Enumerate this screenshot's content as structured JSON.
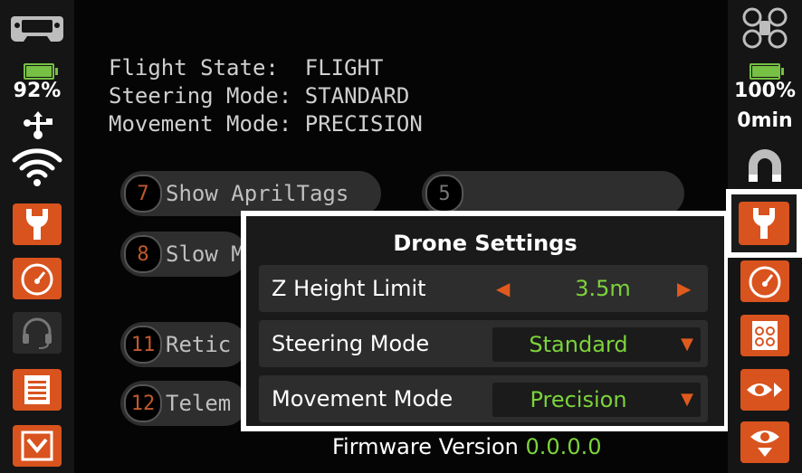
{
  "left_sidebar": {
    "battery_percent": "92%",
    "battery_level": 0.92
  },
  "right_sidebar": {
    "battery_percent": "100%",
    "flight_time": "0min",
    "battery_level": 1.0
  },
  "status": {
    "flight_state_label": "Flight State:",
    "flight_state_value": "FLIGHT",
    "steering_mode_label": "Steering Mode:",
    "steering_mode_value": "STANDARD",
    "movement_mode_label": "Movement Mode:",
    "movement_mode_value": "PRECISION"
  },
  "buttons": [
    {
      "number": "7",
      "label": "Show AprilTags"
    },
    {
      "number": "5",
      "label": ""
    },
    {
      "number": "8",
      "label": "Slow M"
    },
    {
      "number": "11",
      "label": "Retic"
    },
    {
      "number": "12",
      "label": "Telem"
    }
  ],
  "dialog": {
    "title": "Drone Settings",
    "z_height": {
      "label": "Z Height Limit",
      "value": "3.5m"
    },
    "steering": {
      "label": "Steering Mode",
      "value": "Standard"
    },
    "movement": {
      "label": "Movement Mode",
      "value": "Precision"
    }
  },
  "firmware": {
    "label": "Firmware Version",
    "value": "0.0.0.0"
  },
  "colors": {
    "accent_orange": "#d9531e",
    "value_green": "#7cd33a"
  }
}
